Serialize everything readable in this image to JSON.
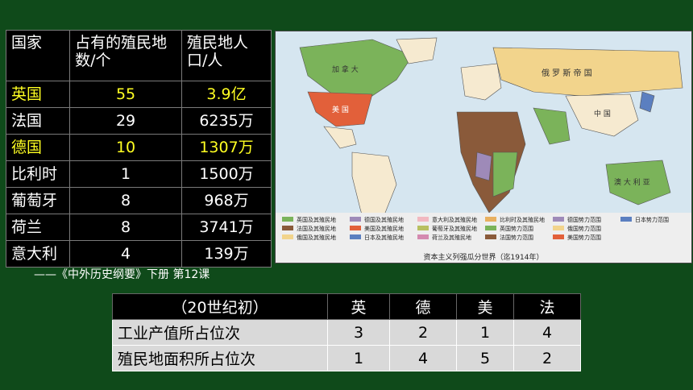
{
  "colonies_table": {
    "headers": [
      "国家",
      "占有的殖民地数/个",
      "殖民地人口/人"
    ],
    "rows": [
      {
        "country": "英国",
        "count": "55",
        "population": "3.9亿",
        "highlight": true
      },
      {
        "country": "法国",
        "count": "29",
        "population": "6235万",
        "highlight": false
      },
      {
        "country": "德国",
        "count": "10",
        "population": "1307万",
        "highlight": true
      },
      {
        "country": "比利时",
        "count": "1",
        "population": "1500万",
        "highlight": false
      },
      {
        "country": "葡萄牙",
        "count": "8",
        "population": "968万",
        "highlight": false
      },
      {
        "country": "荷兰",
        "count": "8",
        "population": "3741万",
        "highlight": false
      },
      {
        "country": "意大利",
        "count": "4",
        "population": "139万",
        "highlight": false
      }
    ],
    "highlight_color": "#ffff22"
  },
  "map": {
    "caption": "资本主义列强瓜分世界（迄1914年）",
    "labels": {
      "russia": "俄 罗 斯 帝 国",
      "china": "中 国",
      "usa": "美 国",
      "australia": "澳 大 利 亚",
      "canada": "加 拿 大"
    },
    "legend": [
      {
        "label": "英国及其殖民地",
        "color": "#7bb35a"
      },
      {
        "label": "法国及其殖民地",
        "color": "#8a5a3a"
      },
      {
        "label": "俄国及其殖民地",
        "color": "#f2d48c"
      },
      {
        "label": "德国及其殖民地",
        "color": "#9e8ab8"
      },
      {
        "label": "美国及其殖民地",
        "color": "#e2603a"
      },
      {
        "label": "日本及其殖民地",
        "color": "#5b7fc0"
      },
      {
        "label": "意大利及其殖民地",
        "color": "#f2b8c0"
      },
      {
        "label": "葡萄牙及其殖民地",
        "color": "#b8c060"
      },
      {
        "label": "荷兰及其殖民地",
        "color": "#d48ab0"
      },
      {
        "label": "比利时及其殖民地",
        "color": "#e8b060"
      },
      {
        "label": "英国势力范围",
        "color": "#7bb35a"
      },
      {
        "label": "法国势力范围",
        "color": "#8a5a3a"
      },
      {
        "label": "德国势力范围",
        "color": "#9e8ab8"
      },
      {
        "label": "俄国势力范围",
        "color": "#f2d48c"
      },
      {
        "label": "美国势力范围",
        "color": "#e2603a"
      },
      {
        "label": "日本势力范围",
        "color": "#5b7fc0"
      }
    ]
  },
  "source": "——《中外历史纲要》下册 第12课",
  "rank_table": {
    "headers": [
      "（20世纪初）",
      "英",
      "德",
      "美",
      "法"
    ],
    "rows": [
      {
        "label": "工业产值所占位次",
        "values": [
          "3",
          "2",
          "1",
          "4"
        ]
      },
      {
        "label": "殖民地面积所占位次",
        "values": [
          "1",
          "4",
          "5",
          "2"
        ]
      }
    ]
  }
}
